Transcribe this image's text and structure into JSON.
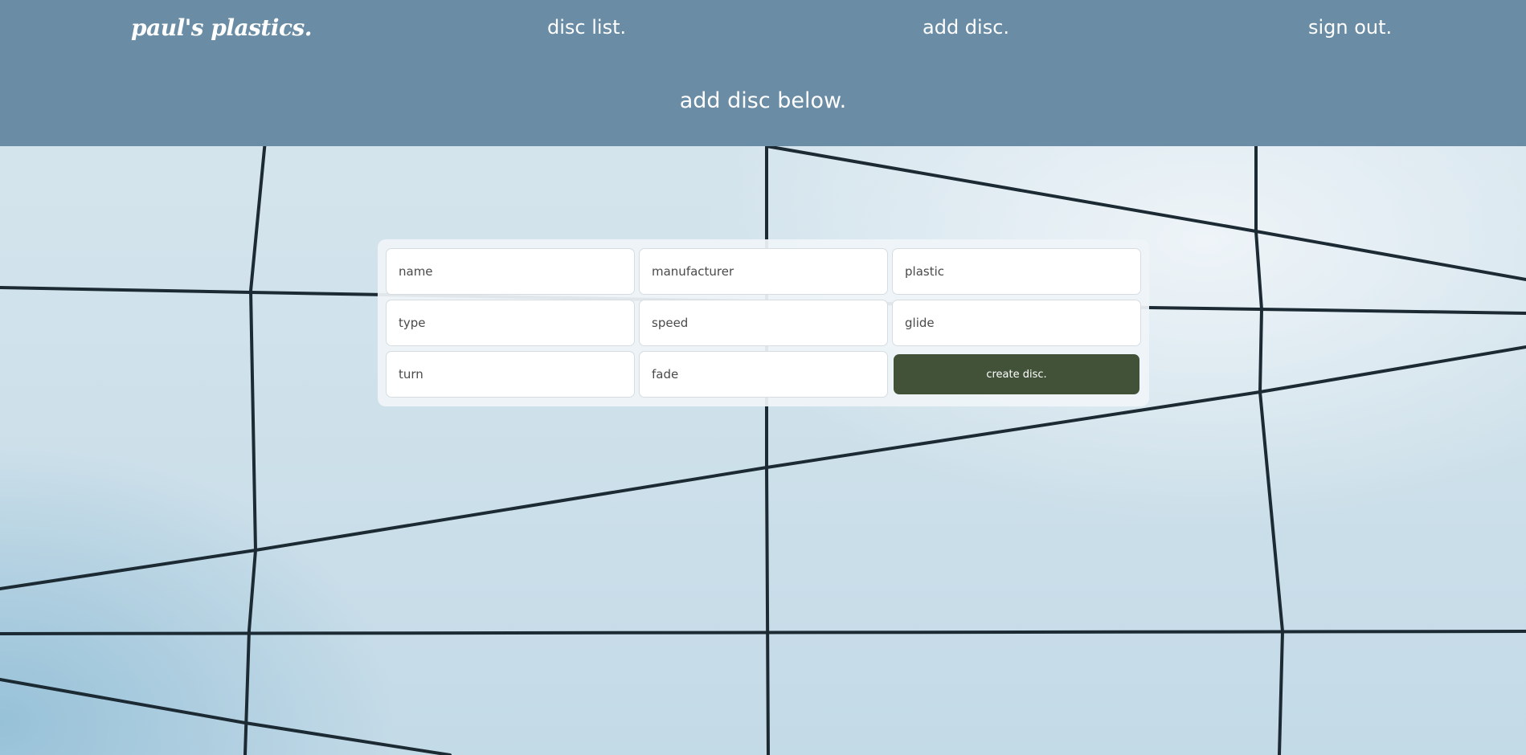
{
  "nav": {
    "brand": "paul's plastics.",
    "links": {
      "disc_list": "disc list.",
      "add_disc": "add disc.",
      "sign_out": "sign out."
    }
  },
  "page": {
    "heading": "add disc below."
  },
  "form": {
    "fields": {
      "name": {
        "placeholder": "name",
        "value": ""
      },
      "manufacturer": {
        "placeholder": "manufacturer",
        "value": ""
      },
      "plastic": {
        "placeholder": "plastic",
        "value": ""
      },
      "type": {
        "placeholder": "type",
        "value": ""
      },
      "speed": {
        "placeholder": "speed",
        "value": ""
      },
      "glide": {
        "placeholder": "glide",
        "value": ""
      },
      "turn": {
        "placeholder": "turn",
        "value": ""
      },
      "fade": {
        "placeholder": "fade",
        "value": ""
      }
    },
    "submit_label": "create disc."
  },
  "colors": {
    "header_bg": "#6a8ca4",
    "button_bg": "#425239",
    "text_light": "#ffffff"
  }
}
